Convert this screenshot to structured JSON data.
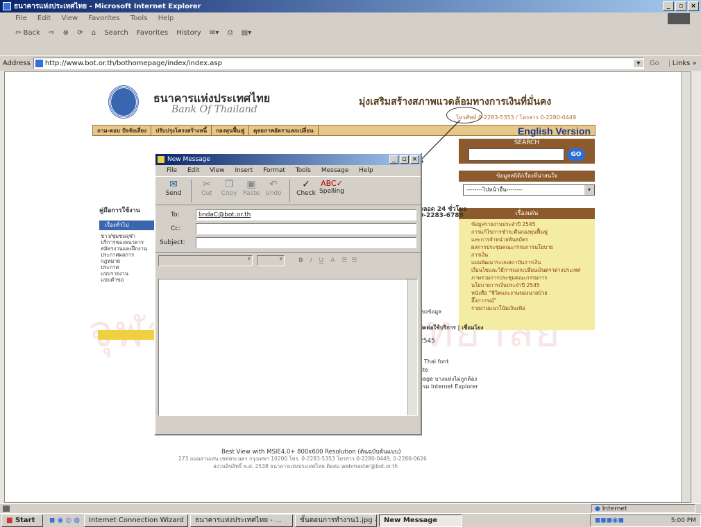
{
  "ie": {
    "title": "ธนาคารแห่งประเทศไทย - Microsoft Internet Explorer",
    "menu": [
      "File",
      "Edit",
      "View",
      "Favorites",
      "Tools",
      "Help"
    ],
    "toolbar": [
      "⇦ Back",
      "⇨",
      "⊗",
      "⟳",
      "⌂",
      "Search",
      "Favorites",
      "History"
    ],
    "address_label": "Address",
    "url": "http://www.bot.or.th/bothomepage/index/index.asp",
    "go": "Go",
    "links": "Links »",
    "status_zone": "Internet"
  },
  "site": {
    "name_th": "ธนาคารแห่งประเทศไทย",
    "name_en": "Bank Of Thailand",
    "slogan": "มุ่งเสริมสร้างสภาพแวดล้อมทางการเงินที่มั่นคง",
    "contact": "โทรศัพท์ 0-2283-5353 / โทรสาร 0-2280-0449",
    "nav": [
      "ถาม-ตอบ ปัจจัยเสี่ยง",
      "ปรับปรุงโครงสร้างหนี้",
      "กองทุนฟื้นฟู",
      "ดุลยภาพอัตราแลกเปลี่ยน"
    ],
    "english": "English Version",
    "search_header": "SEARCH",
    "go": "GO",
    "stats_header": "ข้อมูลสถิติ/เรื่องที่น่าสนใจ",
    "select_value": "--------ไปหน้าอื่น--------",
    "news_header": "เรื่องเด่น",
    "news": [
      "ข้อมูลรายงานประจำปี 2545",
      "การแก้ไขการชำระคืนกองทุนฟื้นฟู",
      "และการจำหน่ายพันธบัตร",
      "ผลการประชุมคณะกรรมการนโยบาย",
      "การเงิน",
      "แผนพัฒนาระบบสถาบันการเงิน",
      "เงื่อนไขและวิธีการแลกเปลี่ยนเงินตราต่างประเทศ",
      "ภาพรวมการประชุมคณะกรรมการ",
      "นโยบายการเงินประจำปี 2545",
      "หนังสือ \"ชีวิตและงานของนายป๋วย",
      "อึ๊งภากรณ์\"",
      "รายงานแนวโน้มเงินเฟ้อ"
    ],
    "side_header": "คู่มือการใช้งาน",
    "side_tab": "เรื่องทั่วไป",
    "side_items": [
      "ข่าว/ชุมชนจุฬา",
      "บริการของธนาคาร",
      "สมัครงานและฝึกงาน",
      "ประกาศผลการ",
      "กฎหมาย",
      "ประกาศ",
      "แบบรายงาน",
      "แบบคำขอ"
    ],
    "phone_time": "ตลอด 24 ชั่วโมง",
    "phone": "0-2283-6789",
    "frag_info": "ขอข้อมูล",
    "frag_service": "ติดต่อใช้บริการ | เชื่อมโยง",
    "frag_num": "2545",
    "frag_font": "ll Thai font",
    "frag_delete": "ete",
    "frag_page": "page บางแห่งไม่ถูกต้อง",
    "frag_ie": "กรม Internet Explorer",
    "footer1": "Best View with MSIE4.0+ 800x600 Resolution (ต้นฉบับต้นแบบ)",
    "footer2": "273 ถนนสามเสน เขตพระนคร กรุงเทพฯ 10200 โทร. 0-2283-5353 โทรสาร 0-2280-0449, 0-2280-0626",
    "footer3": "สงวนลิขสิทธิ์ พ.ศ. 2538 ธนาคารแห่งประเทศไทย ติดต่อ webmaster@bot.or.th",
    "watermark": "จุฬาลงกรณ์มหาวิทยาลัย"
  },
  "msg": {
    "title": "New Message",
    "menu": [
      "File",
      "Edit",
      "View",
      "Insert",
      "Format",
      "Tools",
      "Message",
      "Help"
    ],
    "toolbar": [
      "Send",
      "Cut",
      "Copy",
      "Paste",
      "Undo",
      "Check",
      "Spelling"
    ],
    "to_label": "To:",
    "to_value": "lindaC@bot.or.th",
    "cc_label": "Cc:",
    "subject_label": "Subject:",
    "format_buttons": [
      "B",
      "I",
      "U",
      "A",
      "☰",
      "☰"
    ]
  },
  "taskbar": {
    "start": "Start",
    "items": [
      "Internet Connection Wizard",
      "ธนาคารแห่งประเทศไทย - ...",
      "ขั้นตอนการทำงาน1.jpg - ...",
      "New Message"
    ],
    "clock": "5:00 PM"
  }
}
